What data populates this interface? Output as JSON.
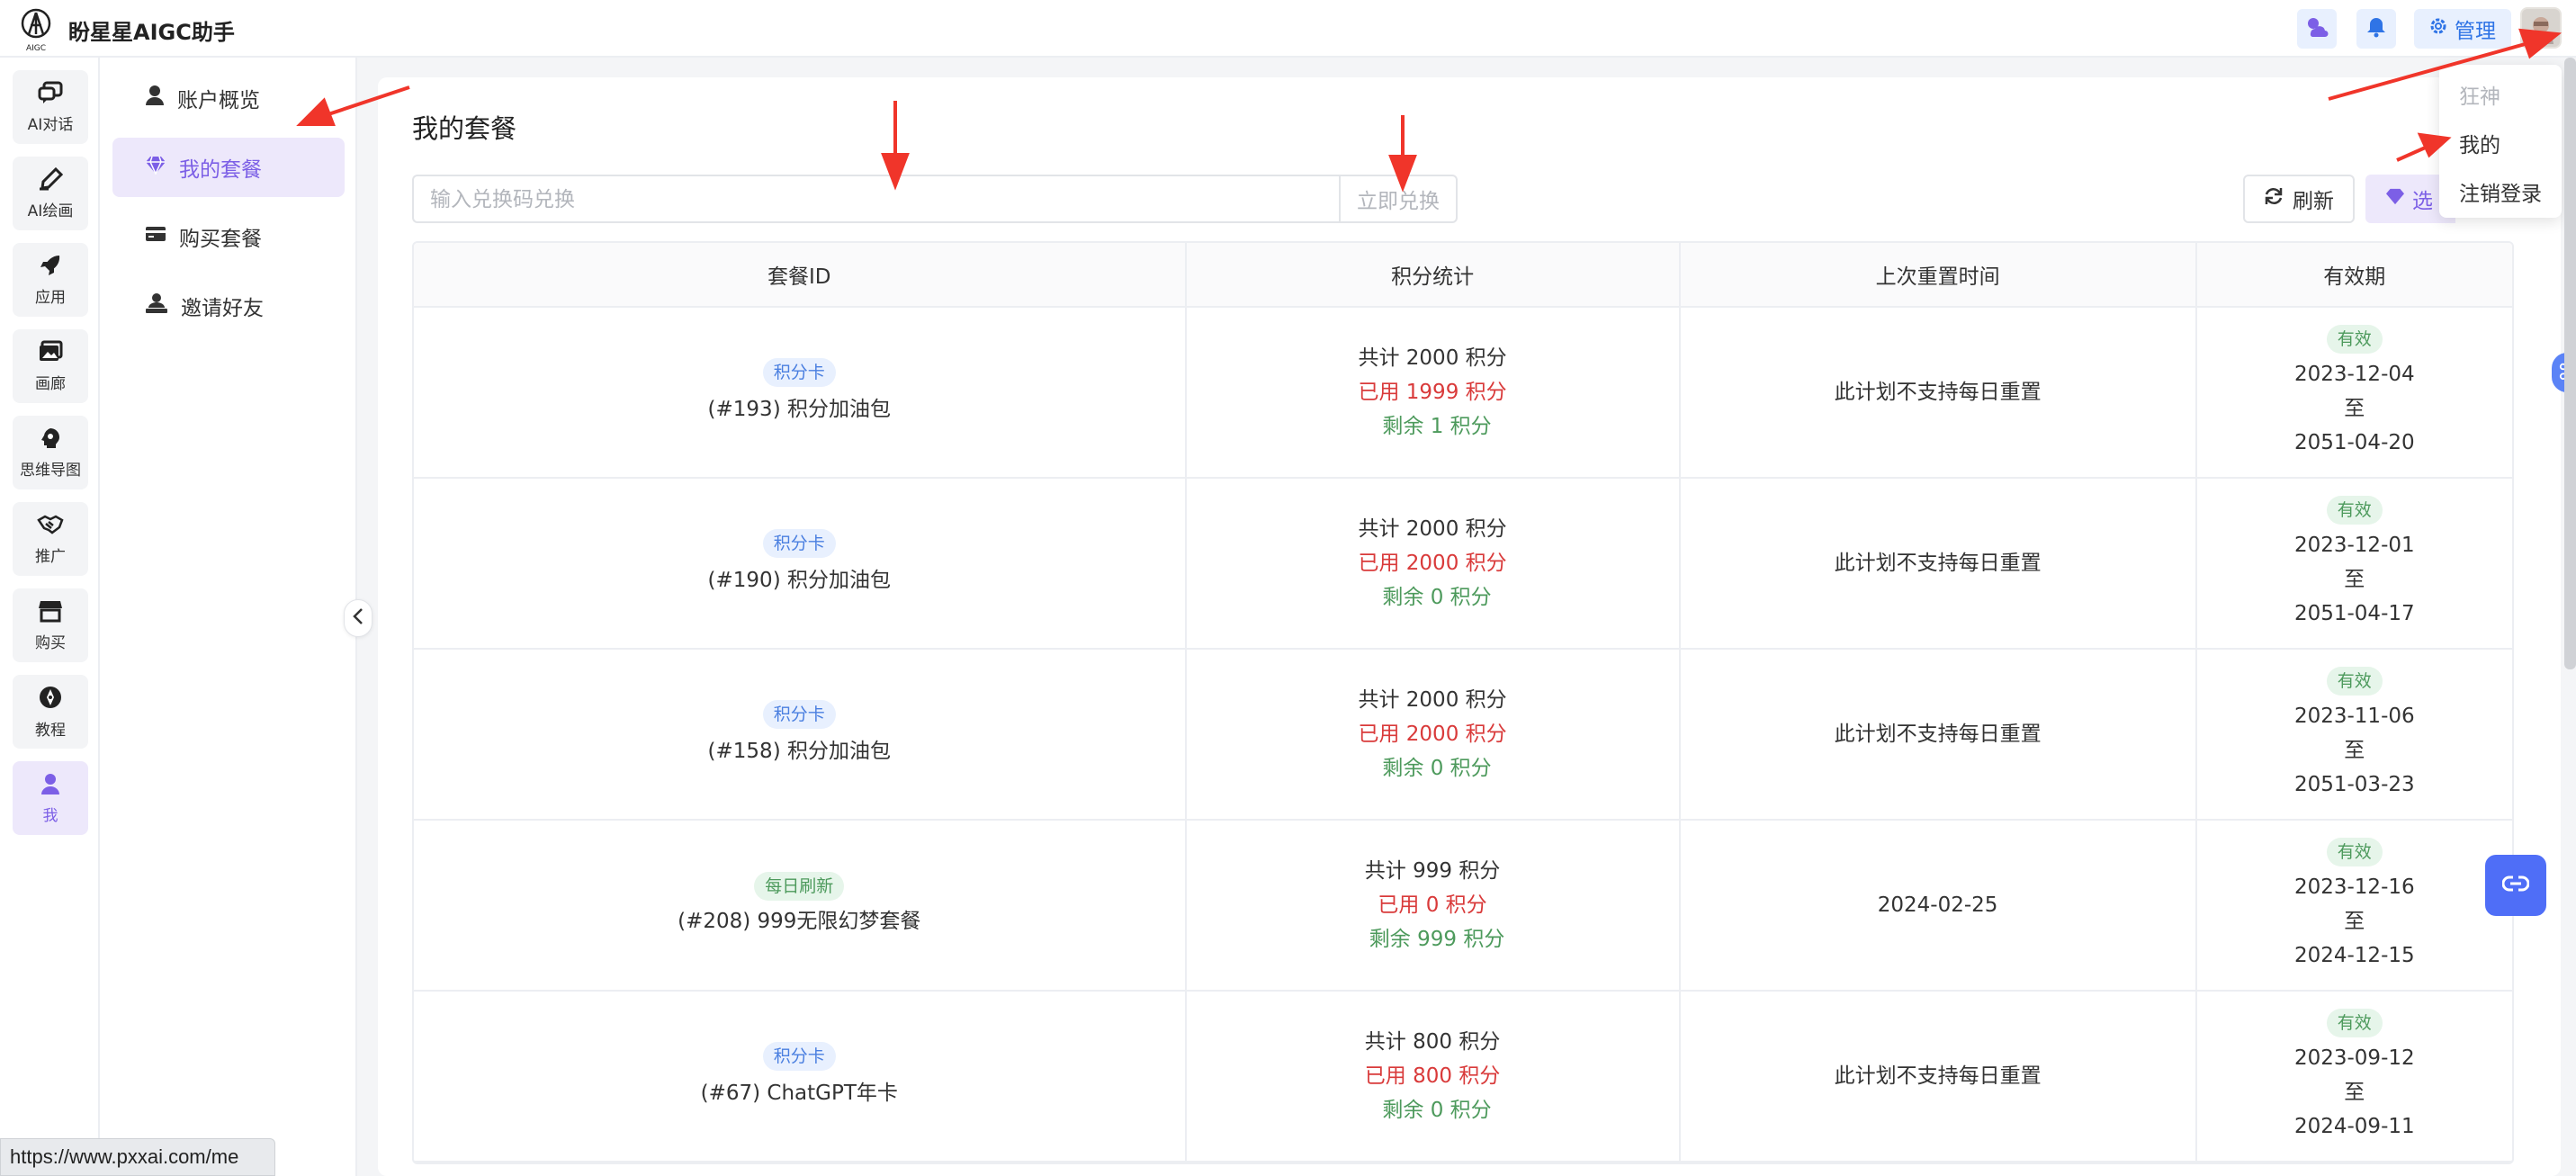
{
  "app": {
    "title": "盼星星AIGC助手",
    "logo_text": "AIGC"
  },
  "header": {
    "weather_icon": "weather-icon",
    "bell_icon": "bell-icon",
    "admin_label": "管理"
  },
  "rail": {
    "items": [
      {
        "label": "AI对话",
        "icon": "chat-icon"
      },
      {
        "label": "AI绘画",
        "icon": "paint-icon"
      },
      {
        "label": "应用",
        "icon": "rocket-icon"
      },
      {
        "label": "画廊",
        "icon": "gallery-icon"
      },
      {
        "label": "思维导图",
        "icon": "mindmap-icon"
      },
      {
        "label": "推广",
        "icon": "handshake-icon"
      },
      {
        "label": "购买",
        "icon": "store-icon"
      },
      {
        "label": "教程",
        "icon": "compass-icon"
      },
      {
        "label": "我",
        "icon": "user-icon"
      }
    ]
  },
  "subnav": {
    "items": [
      {
        "label": "账户概览",
        "icon": "user-icon"
      },
      {
        "label": "我的套餐",
        "icon": "diamond-icon"
      },
      {
        "label": "购买套餐",
        "icon": "card-icon"
      },
      {
        "label": "邀请好友",
        "icon": "invite-icon"
      }
    ]
  },
  "main": {
    "title": "我的套餐",
    "redeem": {
      "placeholder": "输入兑换码兑换",
      "button": "立即兑换"
    },
    "refresh": "刷新",
    "select": "选"
  },
  "table": {
    "headers": [
      "套餐ID",
      "积分统计",
      "上次重置时间",
      "有效期"
    ],
    "rows": [
      {
        "tag": "积分卡",
        "name": "(#193) 积分加油包",
        "total": "共计 2000 积分",
        "used": "已用 1999 积分",
        "remain": "剩余 1 积分",
        "reset": "此计划不支持每日重置",
        "status": "有效",
        "start": "2023-12-04",
        "to": "至",
        "end": "2051-04-20"
      },
      {
        "tag": "积分卡",
        "name": "(#190) 积分加油包",
        "total": "共计 2000 积分",
        "used": "已用 2000 积分",
        "remain": "剩余 0 积分",
        "reset": "此计划不支持每日重置",
        "status": "有效",
        "start": "2023-12-01",
        "to": "至",
        "end": "2051-04-17"
      },
      {
        "tag": "积分卡",
        "name": "(#158) 积分加油包",
        "total": "共计 2000 积分",
        "used": "已用 2000 积分",
        "remain": "剩余 0 积分",
        "reset": "此计划不支持每日重置",
        "status": "有效",
        "start": "2023-11-06",
        "to": "至",
        "end": "2051-03-23"
      },
      {
        "tag": "每日刷新",
        "name": "(#208) 999无限幻梦套餐",
        "total": "共计 999 积分",
        "used": "已用 0 积分",
        "remain": "剩余 999 积分",
        "reset": "2024-02-25",
        "status": "有效",
        "start": "2023-12-16",
        "to": "至",
        "end": "2024-12-15"
      },
      {
        "tag": "积分卡",
        "name": "(#67) ChatGPT年卡",
        "total": "共计 800 积分",
        "used": "已用 800 积分",
        "remain": "剩余 0 积分",
        "reset": "此计划不支持每日重置",
        "status": "有效",
        "start": "2023-09-12",
        "to": "至",
        "end": "2024-09-11"
      }
    ]
  },
  "dropdown": {
    "items": [
      "狂神",
      "我的",
      "注销登录"
    ]
  },
  "statusbar": {
    "url": "https://www.pxxai.com/me"
  },
  "colors": {
    "accent": "#7c5fe6",
    "blue": "#2f74e6",
    "used": "#d93a3a",
    "remain": "#4d9a5c",
    "annotation": "#f0352a"
  }
}
